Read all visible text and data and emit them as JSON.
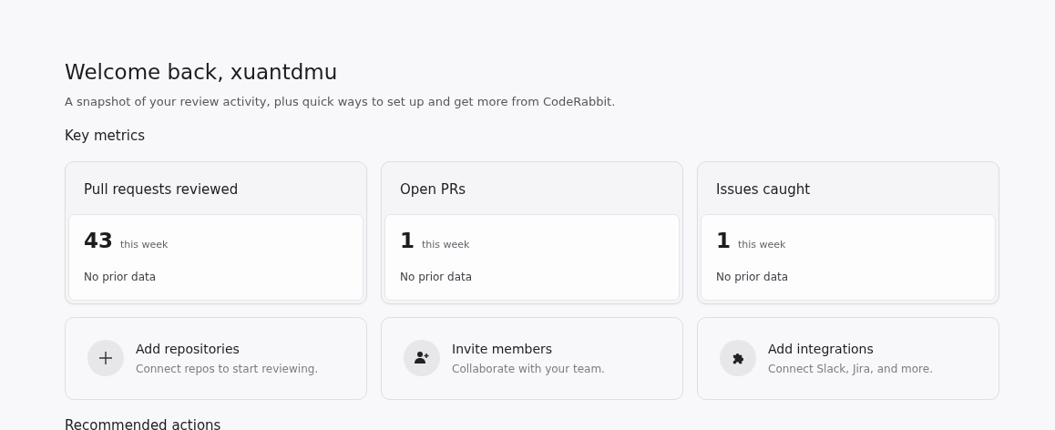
{
  "heading": "Welcome back, xuantdmu",
  "subtitle": "A snapshot of your review activity, plus quick ways to set up and get more from CodeRabbit.",
  "metrics_title": "Key metrics",
  "metrics": [
    {
      "title": "Pull requests reviewed",
      "value": "43",
      "period": "this week",
      "comparison": "No prior data"
    },
    {
      "title": "Open PRs",
      "value": "1",
      "period": "this week",
      "comparison": "No prior data"
    },
    {
      "title": "Issues caught",
      "value": "1",
      "period": "this week",
      "comparison": "No prior data"
    }
  ],
  "actions": [
    {
      "title": "Add repositories",
      "description": "Connect repos to start reviewing."
    },
    {
      "title": "Invite members",
      "description": "Collaborate with your team."
    },
    {
      "title": "Add integrations",
      "description": "Connect Slack, Jira, and more."
    }
  ],
  "recommended_title": "Recommended actions"
}
